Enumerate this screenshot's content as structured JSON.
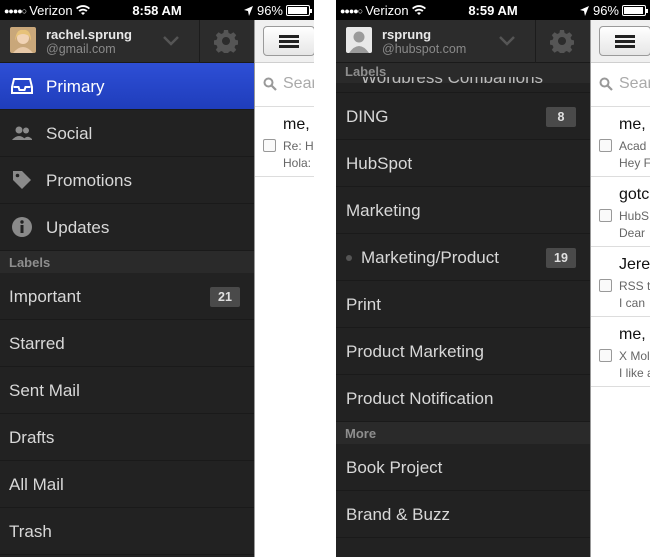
{
  "left": {
    "status": {
      "carrier": "Verizon",
      "time": "8:58 AM",
      "battery": "96%"
    },
    "account": {
      "name": "rachel.sprung",
      "email": "@gmail.com"
    },
    "system_items": [
      {
        "label": "Primary",
        "icon": "inbox-icon"
      },
      {
        "label": "Social",
        "icon": "people-icon"
      },
      {
        "label": "Promotions",
        "icon": "tag-icon"
      },
      {
        "label": "Updates",
        "icon": "info-icon"
      }
    ],
    "labels_header": "Labels",
    "labels": [
      {
        "label": "Important",
        "count": "21"
      },
      {
        "label": "Starred",
        "count": ""
      },
      {
        "label": "Sent Mail",
        "count": ""
      },
      {
        "label": "Drafts",
        "count": ""
      },
      {
        "label": "All Mail",
        "count": ""
      },
      {
        "label": "Trash",
        "count": ""
      }
    ],
    "peek": {
      "search_placeholder": "Sear",
      "messages": [
        {
          "from": "me,",
          "subject": "Re: H",
          "snippet": "Hola:"
        }
      ]
    }
  },
  "right": {
    "status": {
      "carrier": "Verizon",
      "time": "8:59 AM",
      "battery": "96%"
    },
    "account": {
      "name": "rsprung",
      "email": "@hubspot.com"
    },
    "labels_header": "Labels",
    "partial_label": "Wordpress Companions",
    "labels": [
      {
        "label": "DING",
        "count": "8"
      },
      {
        "label": "HubSpot",
        "count": ""
      },
      {
        "label": "Marketing",
        "count": ""
      },
      {
        "label": "Marketing/Product",
        "count": "19"
      },
      {
        "label": "Print",
        "count": ""
      },
      {
        "label": "Product Marketing",
        "count": ""
      },
      {
        "label": "Product Notification",
        "count": ""
      }
    ],
    "more_header": "More",
    "more": [
      {
        "label": "Book Project"
      },
      {
        "label": "Brand & Buzz"
      }
    ],
    "peek": {
      "search_placeholder": "Sear",
      "messages": [
        {
          "from": "me,",
          "subject": "Acad",
          "snippet": "Hey F"
        },
        {
          "from": "gotc",
          "subject": "HubS",
          "snippet": "Dear"
        },
        {
          "from": "Jere",
          "subject": "RSS t",
          "snippet": "I can"
        },
        {
          "from": "me,",
          "subject": "X Mol",
          "snippet": "I like a"
        }
      ]
    }
  },
  "colors": {
    "selected": "#2546cc",
    "drawer": "#222222",
    "badge": "#4a4a4a"
  }
}
